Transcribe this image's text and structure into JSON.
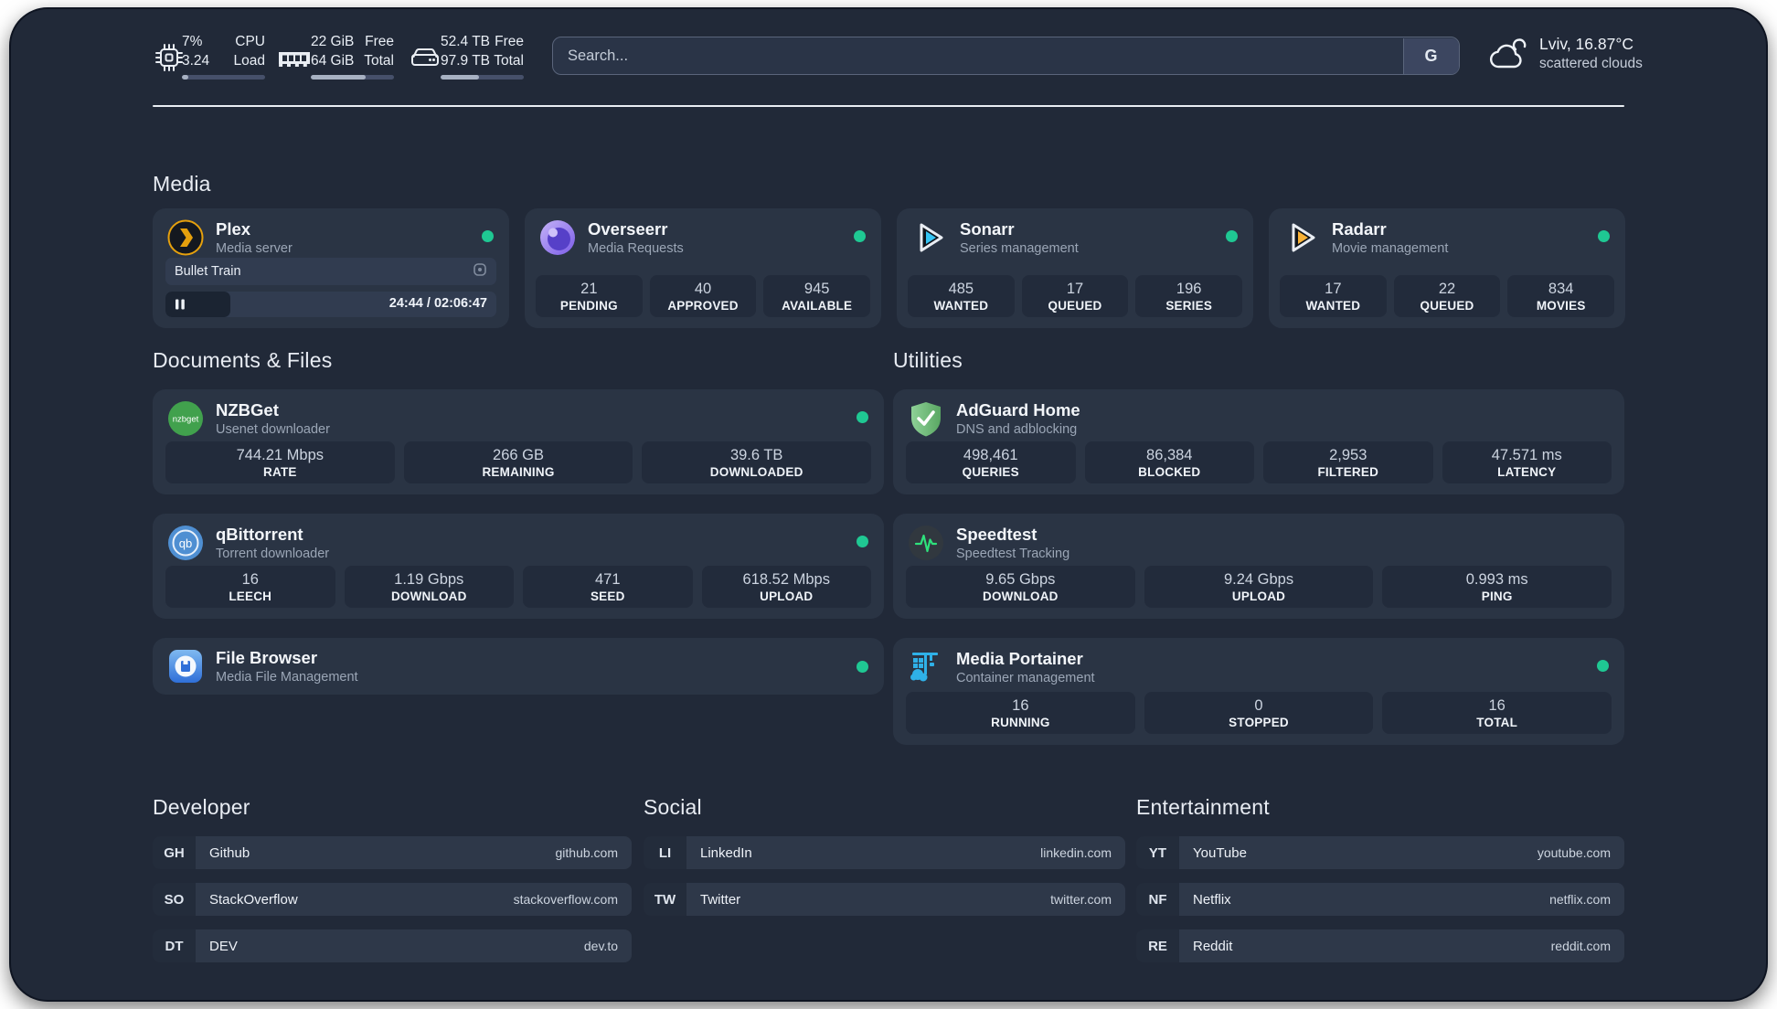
{
  "topbar": {
    "cpu": {
      "value1": "7%",
      "value2": "3.24",
      "label1": "CPU",
      "label2": "Load",
      "progress": 8
    },
    "memory": {
      "value1": "22 GiB",
      "value2": "64 GiB",
      "label1": "Free",
      "label2": "Total",
      "progress": 66
    },
    "disk": {
      "value1": "52.4 TB",
      "value2": "97.9 TB",
      "label1": "Free",
      "label2": "Total",
      "progress": 46
    },
    "search": {
      "placeholder": "Search...",
      "button_label": "G"
    },
    "weather": {
      "location": "Lviv, 16.87°C",
      "condition": "scattered clouds"
    }
  },
  "sections": {
    "media": {
      "title": "Media"
    },
    "documents": {
      "title": "Documents & Files"
    },
    "utilities": {
      "title": "Utilities"
    },
    "developer": {
      "title": "Developer"
    },
    "social": {
      "title": "Social"
    },
    "entertainment": {
      "title": "Entertainment"
    }
  },
  "apps": {
    "plex": {
      "name": "Plex",
      "desc": "Media server",
      "status": "online",
      "player": {
        "title": "Bullet Train",
        "time": "24:44 / 02:06:47",
        "progress": 19.5
      }
    },
    "overseerr": {
      "name": "Overseerr",
      "desc": "Media Requests",
      "status": "online",
      "stats": [
        {
          "value": "21",
          "label": "PENDING"
        },
        {
          "value": "40",
          "label": "APPROVED"
        },
        {
          "value": "945",
          "label": "AVAILABLE"
        }
      ]
    },
    "sonarr": {
      "name": "Sonarr",
      "desc": "Series management",
      "status": "online",
      "stats": [
        {
          "value": "485",
          "label": "WANTED"
        },
        {
          "value": "17",
          "label": "QUEUED"
        },
        {
          "value": "196",
          "label": "SERIES"
        }
      ]
    },
    "radarr": {
      "name": "Radarr",
      "desc": "Movie management",
      "status": "online",
      "stats": [
        {
          "value": "17",
          "label": "WANTED"
        },
        {
          "value": "22",
          "label": "QUEUED"
        },
        {
          "value": "834",
          "label": "MOVIES"
        }
      ]
    },
    "nzbget": {
      "name": "NZBGet",
      "desc": "Usenet downloader",
      "status": "online",
      "stats": [
        {
          "value": "744.21 Mbps",
          "label": "RATE"
        },
        {
          "value": "266 GB",
          "label": "REMAINING"
        },
        {
          "value": "39.6 TB",
          "label": "DOWNLOADED"
        }
      ]
    },
    "qbittorrent": {
      "name": "qBittorrent",
      "desc": "Torrent downloader",
      "status": "online",
      "stats": [
        {
          "value": "16",
          "label": "LEECH"
        },
        {
          "value": "1.19 Gbps",
          "label": "DOWNLOAD"
        },
        {
          "value": "471",
          "label": "SEED"
        },
        {
          "value": "618.52 Mbps",
          "label": "UPLOAD"
        }
      ]
    },
    "filebrowser": {
      "name": "File Browser",
      "desc": "Media File Management",
      "status": "online"
    },
    "adguard": {
      "name": "AdGuard Home",
      "desc": "DNS and adblocking",
      "stats": [
        {
          "value": "498,461",
          "label": "QUERIES"
        },
        {
          "value": "86,384",
          "label": "BLOCKED"
        },
        {
          "value": "2,953",
          "label": "FILTERED"
        },
        {
          "value": "47.571 ms",
          "label": "LATENCY"
        }
      ]
    },
    "speedtest": {
      "name": "Speedtest",
      "desc": "Speedtest Tracking",
      "stats": [
        {
          "value": "9.65 Gbps",
          "label": "DOWNLOAD"
        },
        {
          "value": "9.24 Gbps",
          "label": "UPLOAD"
        },
        {
          "value": "0.993 ms",
          "label": "PING"
        }
      ]
    },
    "portainer": {
      "name": "Media Portainer",
      "desc": "Container management",
      "status": "online",
      "stats": [
        {
          "value": "16",
          "label": "RUNNING"
        },
        {
          "value": "0",
          "label": "STOPPED"
        },
        {
          "value": "16",
          "label": "TOTAL"
        }
      ]
    }
  },
  "bookmarks": {
    "developer": [
      {
        "abbr": "GH",
        "name": "Github",
        "url": "github.com"
      },
      {
        "abbr": "SO",
        "name": "StackOverflow",
        "url": "stackoverflow.com"
      },
      {
        "abbr": "DT",
        "name": "DEV",
        "url": "dev.to"
      }
    ],
    "social": [
      {
        "abbr": "LI",
        "name": "LinkedIn",
        "url": "linkedin.com"
      },
      {
        "abbr": "TW",
        "name": "Twitter",
        "url": "twitter.com"
      }
    ],
    "entertainment": [
      {
        "abbr": "YT",
        "name": "YouTube",
        "url": "youtube.com"
      },
      {
        "abbr": "NF",
        "name": "Netflix",
        "url": "netflix.com"
      },
      {
        "abbr": "RE",
        "name": "Reddit",
        "url": "reddit.com"
      }
    ]
  },
  "colors": {
    "status_online": "#1fc893",
    "plex": "#e5a00d",
    "overseerr": "#7b5ce8",
    "sonarr": "#35c5f4",
    "radarr": "#f9b236",
    "nzbget": "#41a14d",
    "qbittorrent": "#4f8fd2",
    "adguard": "#6cbc75",
    "speedtest_pulse": "#2ee27c",
    "filebrowser": "#2f6fd8",
    "portainer": "#2fb1e8"
  }
}
